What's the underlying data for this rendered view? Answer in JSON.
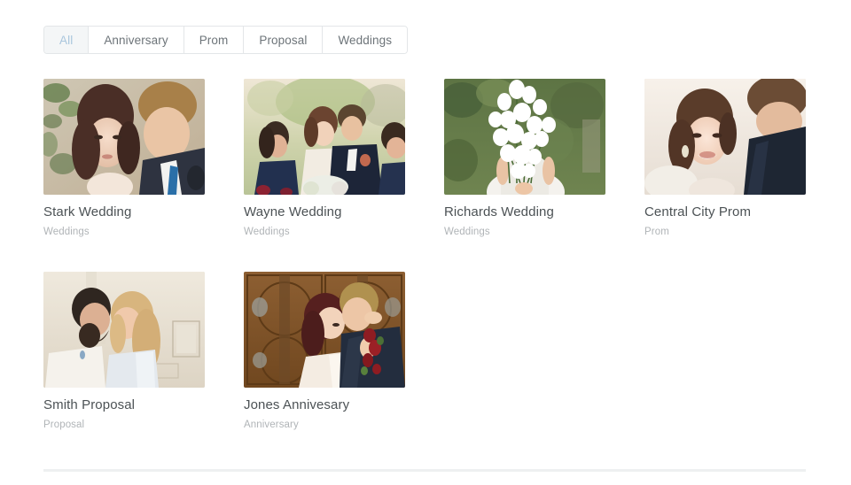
{
  "filters": {
    "name": "category-filter",
    "active": "All",
    "tabs": [
      {
        "label": "All",
        "active": true
      },
      {
        "label": "Anniversary",
        "active": false
      },
      {
        "label": "Prom",
        "active": false
      },
      {
        "label": "Proposal",
        "active": false
      },
      {
        "label": "Weddings",
        "active": false
      }
    ]
  },
  "gallery": {
    "items": [
      {
        "title": "Stark Wedding",
        "category": "Weddings",
        "image": "bride-groom-portrait-foliage"
      },
      {
        "title": "Wayne Wedding",
        "category": "Weddings",
        "image": "wedding-party-group-outdoor"
      },
      {
        "title": "Richards Wedding",
        "category": "Weddings",
        "image": "bride-white-flower-bouquet"
      },
      {
        "title": "Central City Prom",
        "category": "Prom",
        "image": "smiling-woman-updo-with-man"
      },
      {
        "title": "Smith Proposal",
        "category": "Proposal",
        "image": "couple-kissing-beige-wall"
      },
      {
        "title": "Jones Annivesary",
        "category": "Anniversary",
        "image": "couple-wooden-doors-embrace"
      }
    ]
  },
  "colors": {
    "active_tab_text": "#a9c6dd",
    "active_tab_bg": "#f4f6f7",
    "tab_text": "#6d7479",
    "tab_border": "#e3e6e8",
    "title_text": "#4c5255",
    "category_text": "#b0b4b7",
    "divider": "#eef0f1",
    "page_bg": "#ffffff"
  }
}
